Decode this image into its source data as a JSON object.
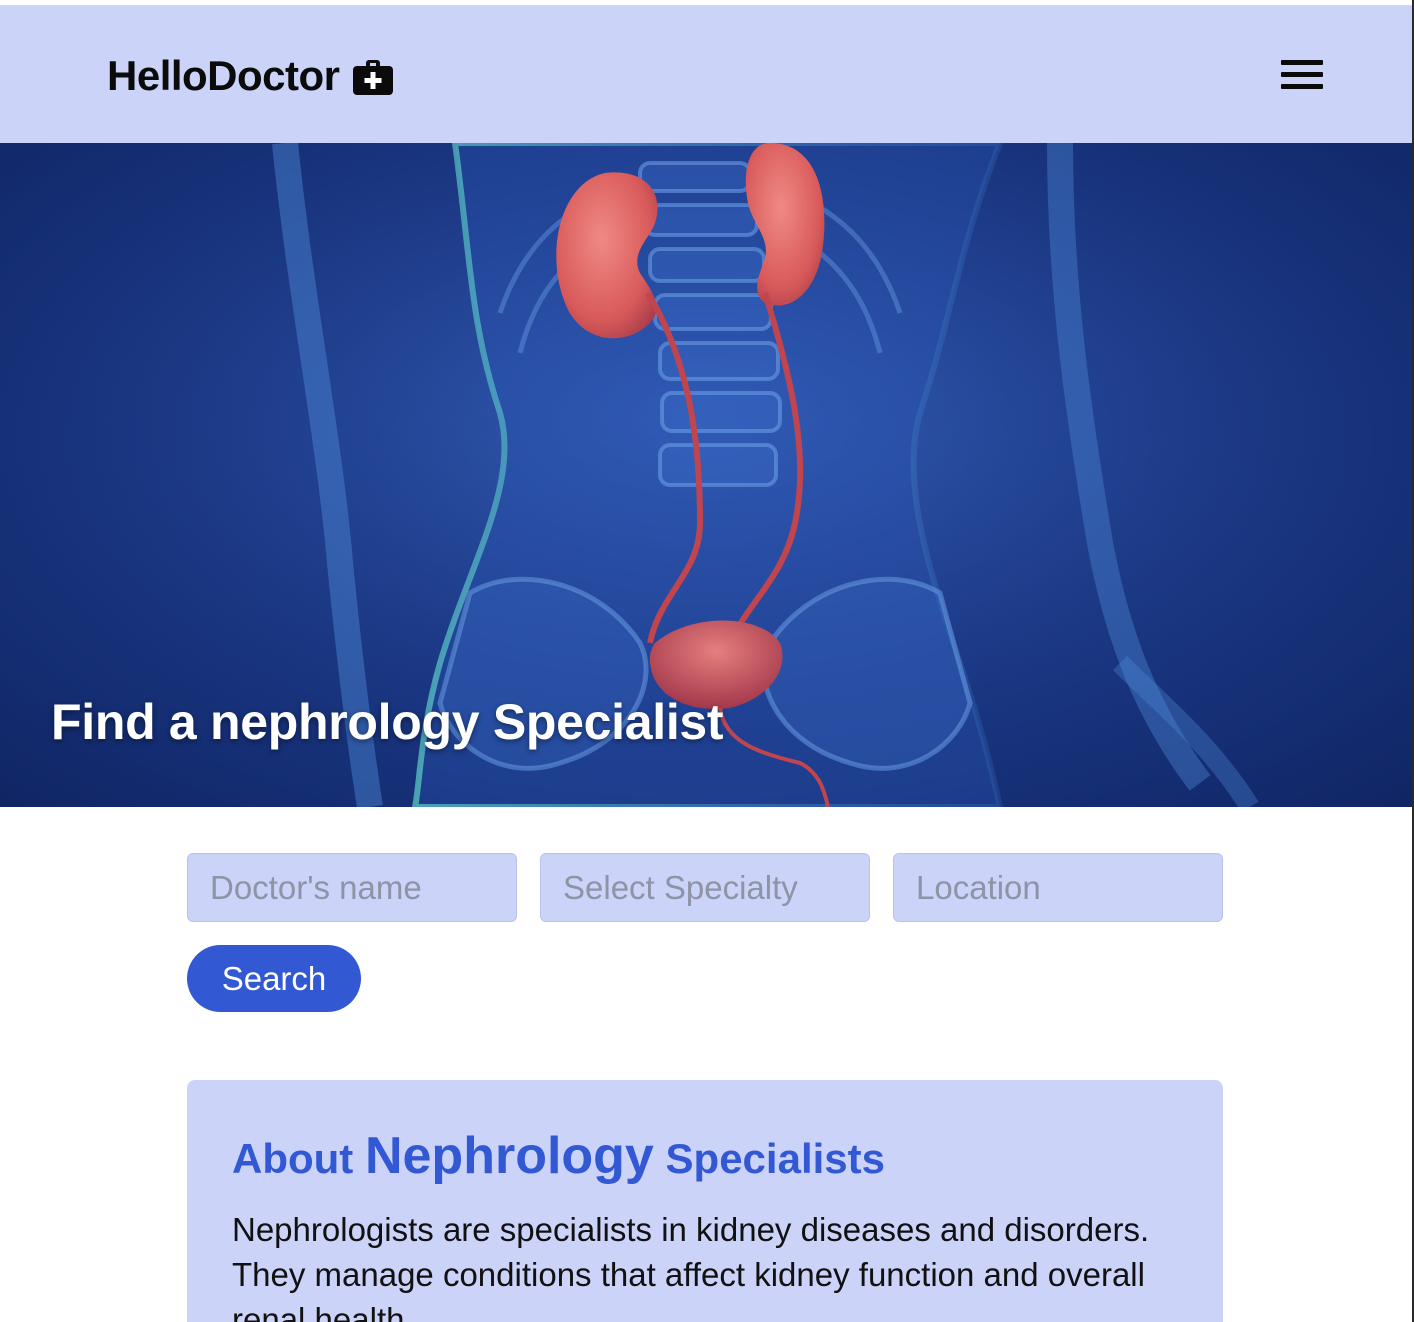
{
  "header": {
    "brand": "HelloDoctor",
    "brand_icon": "medical-kit-icon",
    "menu_icon": "hamburger-menu-icon",
    "background_color": "#cbd3f9"
  },
  "hero": {
    "title": "Find a nephrology Specialist",
    "image_subject": "kidney-urinary-system-illustration"
  },
  "search": {
    "doctor_name_placeholder": "Doctor's name",
    "specialty_placeholder": "Select Specialty",
    "location_placeholder": "Location",
    "button_label": "Search",
    "button_color": "#3358d4"
  },
  "about": {
    "heading_prefix": "About ",
    "heading_emphasis": "Nephrology",
    "heading_suffix": " Specialists",
    "body": "Nephrologists are specialists in kidney diseases and disorders. They manage conditions that affect kidney function and overall renal health.",
    "accent_color": "#3358d4"
  }
}
